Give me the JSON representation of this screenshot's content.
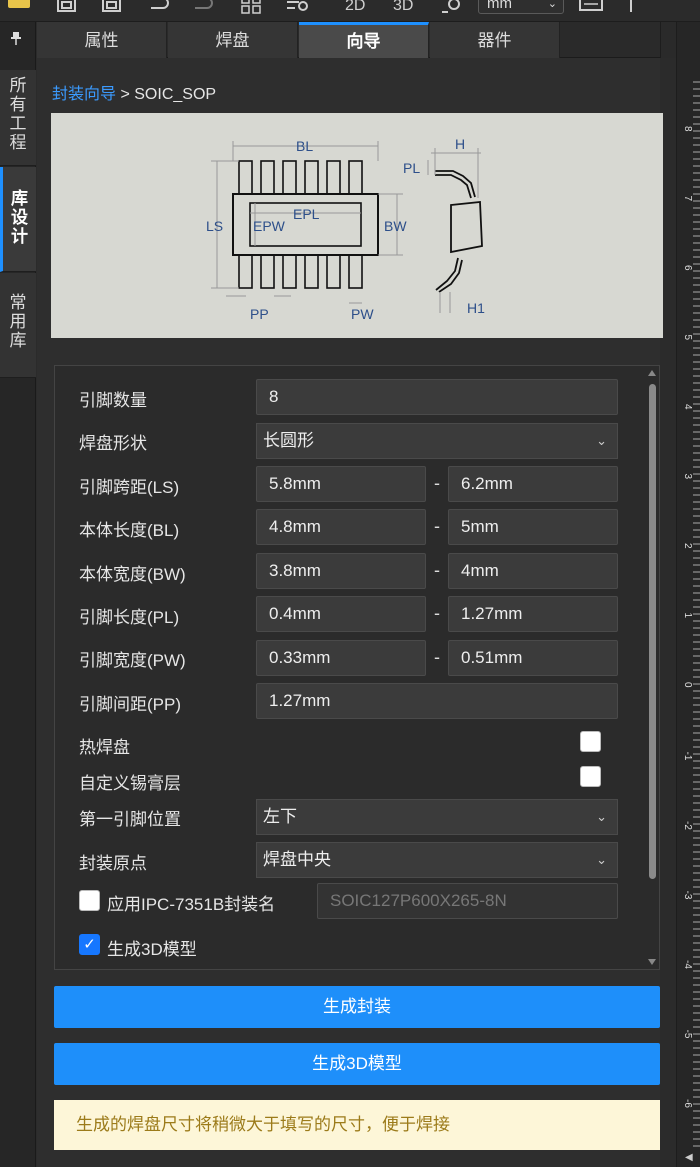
{
  "toolbar": {
    "unit_select": "mm",
    "view_2d": "2D",
    "view_3d": "3D"
  },
  "leftbar": {
    "items": [
      {
        "label": "所有工程"
      },
      {
        "label": "库设计"
      },
      {
        "label": "常用库"
      }
    ]
  },
  "tabs": [
    {
      "label": "属性"
    },
    {
      "label": "焊盘"
    },
    {
      "label": "向导"
    },
    {
      "label": "器件"
    }
  ],
  "breadcrumb": {
    "link": "封装向导",
    "separator": " > ",
    "current": "SOIC_SOP"
  },
  "diagram": {
    "labels": {
      "BL": "BL",
      "LS": "LS",
      "EPL": "EPL",
      "EPW": "EPW",
      "BW": "BW",
      "PP": "PP",
      "PW": "PW",
      "PL": "PL",
      "H": "H",
      "H1": "H1"
    }
  },
  "form": {
    "pin_count": {
      "label": "引脚数量",
      "value": "8"
    },
    "pad_shape": {
      "label": "焊盘形状",
      "value": "长圆形"
    },
    "ls": {
      "label": "引脚跨距(LS)",
      "min": "5.8mm",
      "max": "6.2mm"
    },
    "bl": {
      "label": "本体长度(BL)",
      "min": "4.8mm",
      "max": "5mm"
    },
    "bw": {
      "label": "本体宽度(BW)",
      "min": "3.8mm",
      "max": "4mm"
    },
    "pl": {
      "label": "引脚长度(PL)",
      "min": "0.4mm",
      "max": "1.27mm"
    },
    "pw": {
      "label": "引脚宽度(PW)",
      "min": "0.33mm",
      "max": "0.51mm"
    },
    "pp": {
      "label": "引脚间距(PP)",
      "value": "1.27mm"
    },
    "thermal_pad": {
      "label": "热焊盘"
    },
    "custom_paste": {
      "label": "自定义锡膏层"
    },
    "pin1_pos": {
      "label": "第一引脚位置",
      "value": "左下"
    },
    "origin": {
      "label": "封装原点",
      "value": "焊盘中央"
    },
    "ipc_name": {
      "label": "应用IPC-7351B封装名",
      "placeholder": "SOIC127P600X265-8N"
    },
    "gen_3d": {
      "label": "生成3D模型"
    },
    "dash": "-"
  },
  "buttons": {
    "generate_footprint": "生成封装",
    "generate_3d": "生成3D模型"
  },
  "notice": "生成的焊盘尺寸将稍微大于填写的尺寸，便于焊接",
  "ruler": {
    "ticks": [
      "8",
      "7",
      "6",
      "5",
      "4",
      "3",
      "2",
      "1",
      "0",
      "-1",
      "-2",
      "-3",
      "-4",
      "-5",
      "-6"
    ]
  }
}
